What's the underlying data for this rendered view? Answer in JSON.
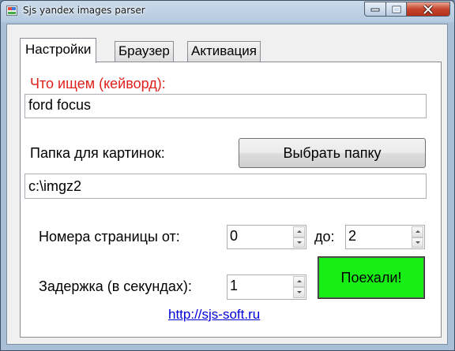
{
  "window": {
    "title": "Sjs yandex images parser",
    "icon": "app-icon",
    "controls": [
      "minimize-icon",
      "maximize-icon",
      "close-icon"
    ]
  },
  "tabs": [
    {
      "label": "Настройки",
      "active": true
    },
    {
      "label": "Браузер",
      "active": false
    },
    {
      "label": "Активация",
      "active": false
    }
  ],
  "settings": {
    "keyword_label": "Что ищем (кейворд):",
    "keyword_value": "ford focus",
    "folder_label": "Папка для картинок:",
    "choose_folder_button": "Выбрать папку",
    "folder_value": "c:\\imgz2",
    "pages_from_label": "Номера страницы от:",
    "pages_from_value": "0",
    "pages_to_label": "до:",
    "pages_to_value": "2",
    "delay_label": "Задержка (в секундах):",
    "delay_value": "1",
    "go_button": "Поехали!",
    "link_text": "http://sjs-soft.ru"
  },
  "colors": {
    "keyword_label": "#e0201c",
    "go_button": "#17ee13",
    "link": "#0000d8"
  }
}
